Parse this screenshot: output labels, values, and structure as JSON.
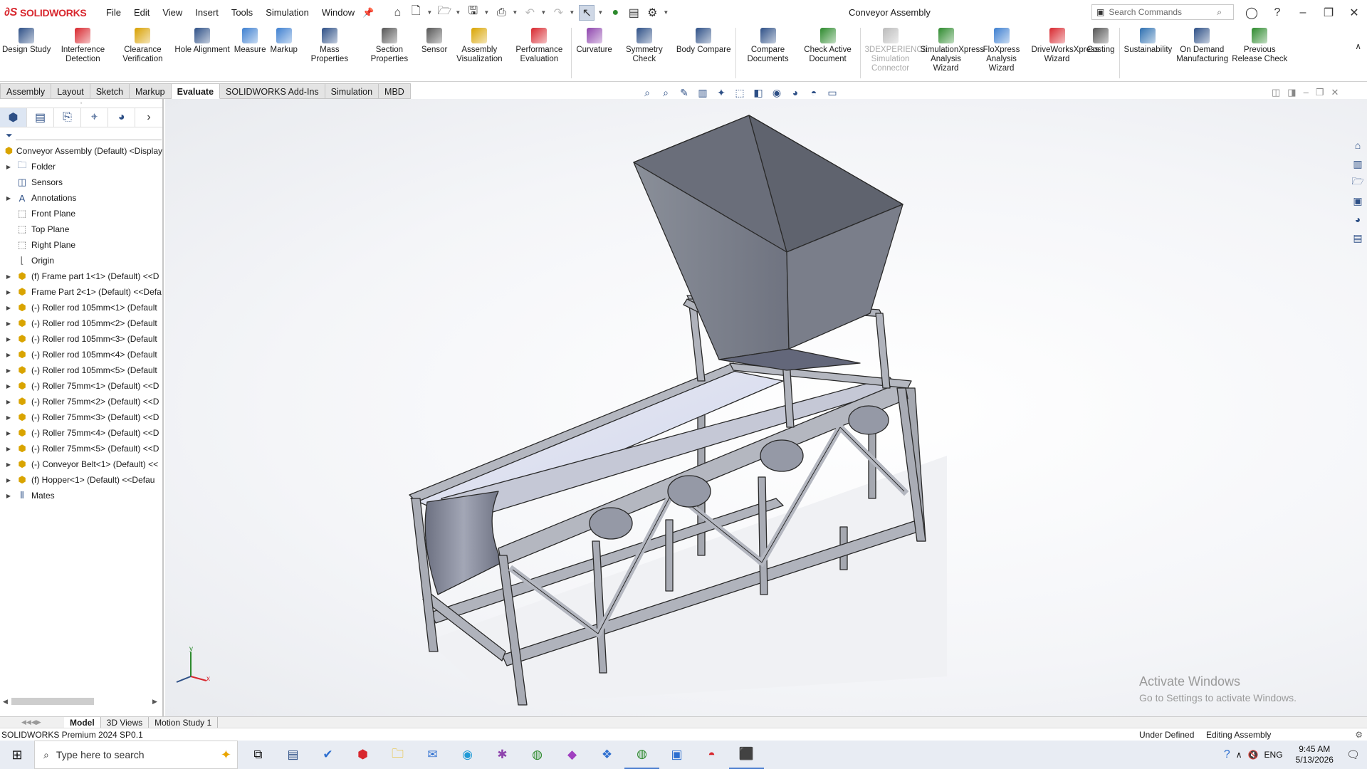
{
  "app": {
    "brand": "SOLIDWORKS",
    "window_title": "Conveyor Assembly"
  },
  "menu": [
    "File",
    "Edit",
    "View",
    "Insert",
    "Tools",
    "Simulation",
    "Window"
  ],
  "search": {
    "placeholder": "Search Commands"
  },
  "ribbon": [
    {
      "label": "Design Study",
      "icon": "design-study-icon",
      "color": "#2d4f86",
      "disabled": false
    },
    {
      "label": "Interference Detection",
      "icon": "interference-icon",
      "color": "#d8272e",
      "disabled": false
    },
    {
      "label": "Clearance Verification",
      "icon": "clearance-icon",
      "color": "#d8a000",
      "disabled": false
    },
    {
      "label": "Hole Alignment",
      "icon": "hole-alignment-icon",
      "color": "#2d4f86",
      "disabled": false
    },
    {
      "label": "Measure",
      "icon": "measure-icon",
      "color": "#3d7fd0",
      "disabled": false
    },
    {
      "label": "Markup",
      "icon": "markup-icon",
      "color": "#3d7fd0",
      "disabled": false
    },
    {
      "label": "Mass Properties",
      "icon": "mass-properties-icon",
      "color": "#2d4f86",
      "disabled": false
    },
    {
      "label": "Section Properties",
      "icon": "section-properties-icon",
      "color": "#555555",
      "disabled": false
    },
    {
      "label": "Sensor",
      "icon": "sensor-icon",
      "color": "#555555",
      "disabled": false
    },
    {
      "label": "Assembly Visualization",
      "icon": "assembly-visualization-icon",
      "color": "#d9a400",
      "disabled": false
    },
    {
      "label": "Performance Evaluation",
      "icon": "performance-icon",
      "color": "#d8272e",
      "disabled": false
    },
    {
      "label": "Curvature",
      "icon": "curvature-icon",
      "color": "#8e44ad",
      "disabled": false
    },
    {
      "label": "Symmetry Check",
      "icon": "symmetry-icon",
      "color": "#2d4f86",
      "disabled": false
    },
    {
      "label": "Body Compare",
      "icon": "body-compare-icon",
      "color": "#2d4f86",
      "disabled": false
    },
    {
      "label": "Compare Documents",
      "icon": "compare-documents-icon",
      "color": "#2d4f86",
      "disabled": false
    },
    {
      "label": "Check Active Document",
      "icon": "check-document-icon",
      "color": "#2d8a2d",
      "disabled": false
    },
    {
      "label": "3DEXPERIENCE Simulation Connector",
      "icon": "3dx-connector-icon",
      "color": "#bbbbbb",
      "disabled": true
    },
    {
      "label": "SimulationXpress Analysis Wizard",
      "icon": "simxpress-icon",
      "color": "#2d8a2d",
      "disabled": false
    },
    {
      "label": "FloXpress Analysis Wizard",
      "icon": "floxpress-icon",
      "color": "#3d7fd0",
      "disabled": false
    },
    {
      "label": "DriveWorksXpress Wizard",
      "icon": "driveworks-icon",
      "color": "#d8272e",
      "disabled": false
    },
    {
      "label": "Costing",
      "icon": "costing-icon",
      "color": "#555555",
      "disabled": false
    },
    {
      "label": "Sustainability",
      "icon": "sustainability-icon",
      "color": "#2d6fb0",
      "disabled": false
    },
    {
      "label": "On Demand Manufacturing",
      "icon": "manufacturing-icon",
      "color": "#2d4f86",
      "disabled": false
    },
    {
      "label": "Previous Release Check",
      "icon": "release-check-icon",
      "color": "#2d8a2d",
      "disabled": false
    }
  ],
  "tabs": [
    "Assembly",
    "Layout",
    "Sketch",
    "Markup",
    "Evaluate",
    "SOLIDWORKS Add-Ins",
    "Simulation",
    "MBD"
  ],
  "active_tab": "Evaluate",
  "tree": {
    "root": "Conveyor Assembly (Default) <Display",
    "items": [
      {
        "label": "Folder",
        "icon": "folder-icon",
        "expand": true,
        "kind": "blue"
      },
      {
        "label": "Sensors",
        "icon": "sensor-icon",
        "expand": false,
        "kind": "blue"
      },
      {
        "label": "Annotations",
        "icon": "annotations-icon",
        "expand": true,
        "kind": "blue"
      },
      {
        "label": "Front Plane",
        "icon": "plane-icon",
        "expand": false,
        "kind": "gray"
      },
      {
        "label": "Top Plane",
        "icon": "plane-icon",
        "expand": false,
        "kind": "gray"
      },
      {
        "label": "Right Plane",
        "icon": "plane-icon",
        "expand": false,
        "kind": "gray"
      },
      {
        "label": "Origin",
        "icon": "origin-icon",
        "expand": false,
        "kind": "gray"
      },
      {
        "label": "(f) Frame part 1<1> (Default) <<D",
        "icon": "part-icon",
        "expand": true,
        "kind": "yel"
      },
      {
        "label": "Frame Part 2<1> (Default) <<Defa",
        "icon": "part-icon",
        "expand": true,
        "kind": "yel"
      },
      {
        "label": "(-) Roller rod 105mm<1> (Default",
        "icon": "part-icon",
        "expand": true,
        "kind": "yel"
      },
      {
        "label": "(-) Roller rod 105mm<2> (Default",
        "icon": "part-icon",
        "expand": true,
        "kind": "yel"
      },
      {
        "label": "(-) Roller rod 105mm<3> (Default",
        "icon": "part-icon",
        "expand": true,
        "kind": "yel"
      },
      {
        "label": "(-) Roller rod 105mm<4> (Default",
        "icon": "part-icon",
        "expand": true,
        "kind": "yel"
      },
      {
        "label": "(-) Roller rod 105mm<5> (Default",
        "icon": "part-icon",
        "expand": true,
        "kind": "yel"
      },
      {
        "label": "(-) Roller 75mm<1> (Default) <<D",
        "icon": "part-icon",
        "expand": true,
        "kind": "yel"
      },
      {
        "label": "(-) Roller 75mm<2> (Default) <<D",
        "icon": "part-icon",
        "expand": true,
        "kind": "yel"
      },
      {
        "label": "(-) Roller 75mm<3> (Default) <<D",
        "icon": "part-icon",
        "expand": true,
        "kind": "yel"
      },
      {
        "label": "(-) Roller 75mm<4> (Default) <<D",
        "icon": "part-icon",
        "expand": true,
        "kind": "yel"
      },
      {
        "label": "(-) Roller 75mm<5> (Default) <<D",
        "icon": "part-icon",
        "expand": true,
        "kind": "yel"
      },
      {
        "label": "(-) Conveyor Belt<1> (Default) <<",
        "icon": "part-icon",
        "expand": true,
        "kind": "yel"
      },
      {
        "label": "(f) Hopper<1> (Default) <<Defau",
        "icon": "part-icon",
        "expand": true,
        "kind": "yel"
      },
      {
        "label": "Mates",
        "icon": "mates-icon",
        "expand": true,
        "kind": "blue"
      }
    ]
  },
  "bottom_tabs": [
    "Model",
    "3D Views",
    "Motion Study 1"
  ],
  "active_bottom_tab": "Model",
  "status": {
    "product": "SOLIDWORKS Premium 2024 SP0.1",
    "state": "Under Defined",
    "mode": "Editing Assembly"
  },
  "watermark": {
    "line1": "Activate Windows",
    "line2": "Go to Settings to activate Windows."
  },
  "triad": {
    "x": "x",
    "y": "y"
  },
  "taskbar": {
    "search_placeholder": "Type here to search",
    "time": "9:45 AM",
    "date": "5/13/2026",
    "lang": "ENG"
  }
}
